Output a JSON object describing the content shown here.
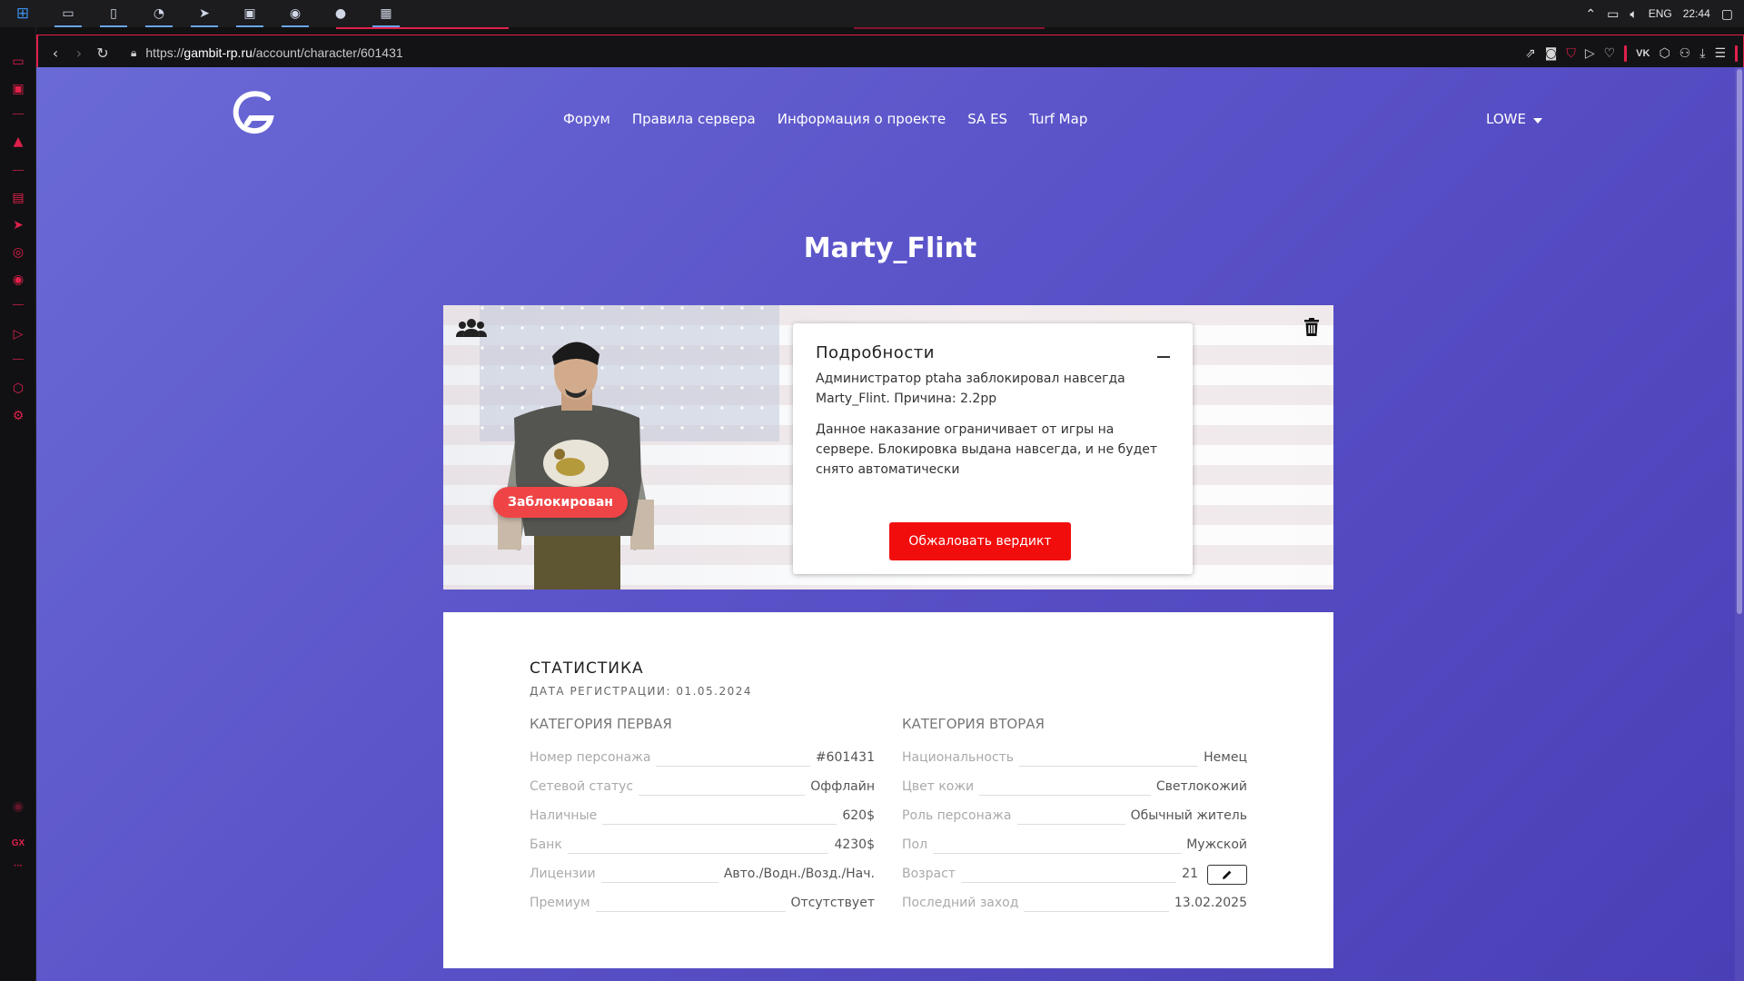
{
  "taskbar": {
    "lang": "ENG",
    "time": "22:44"
  },
  "browser": {
    "url_prefix": "https://",
    "url_host": "gambit-rp.ru",
    "url_path": "/account/character/601431"
  },
  "site": {
    "nav": [
      "Форум",
      "Правила сервера",
      "Информация о проекте",
      "SA ES",
      "Turf Map"
    ],
    "user": "LOWE"
  },
  "character": {
    "name": "Marty_Flint",
    "status_badge": "Заблокирован",
    "details_title": "Подробности",
    "details_text1": "Администратор ptaha заблокировал навсегда Marty_Flint. Причина: 2.2pp",
    "details_text2": "Данное наказание ограничивает от игры на сервере. Блокировка выдана навсегда, и не будет снято автоматически",
    "appeal_label": "Обжаловать вердикт"
  },
  "stats": {
    "title": "СТАТИСТИКА",
    "reg_date": "ДАТА РЕГИСТРАЦИИ: 01.05.2024",
    "cat1_title": "КАТЕГОРИЯ ПЕРВАЯ",
    "cat2_title": "КАТЕГОРИЯ ВТОРАЯ",
    "cat1": [
      {
        "label": "Номер персонажа",
        "value": "#601431"
      },
      {
        "label": "Сетевой статус",
        "value": "Оффлайн"
      },
      {
        "label": "Наличные",
        "value": "620$"
      },
      {
        "label": "Банк",
        "value": "4230$"
      },
      {
        "label": "Лицензии",
        "value": "Авто./Водн./Возд./Нач."
      },
      {
        "label": "Премиум",
        "value": "Отсутствует"
      }
    ],
    "cat2": [
      {
        "label": "Национальность",
        "value": "Немец"
      },
      {
        "label": "Цвет кожи",
        "value": "Светлокожий"
      },
      {
        "label": "Роль персонажа",
        "value": "Обычный житель"
      },
      {
        "label": "Пол",
        "value": "Мужской"
      },
      {
        "label": "Возраст",
        "value": "21"
      },
      {
        "label": "Последний заход",
        "value": "13.02.2025"
      }
    ]
  },
  "colors": {
    "accent": "#e0204a",
    "page_bg": "#5a52c8",
    "appeal_btn": "#f20d0d",
    "ban_badge": "#ef4446"
  }
}
